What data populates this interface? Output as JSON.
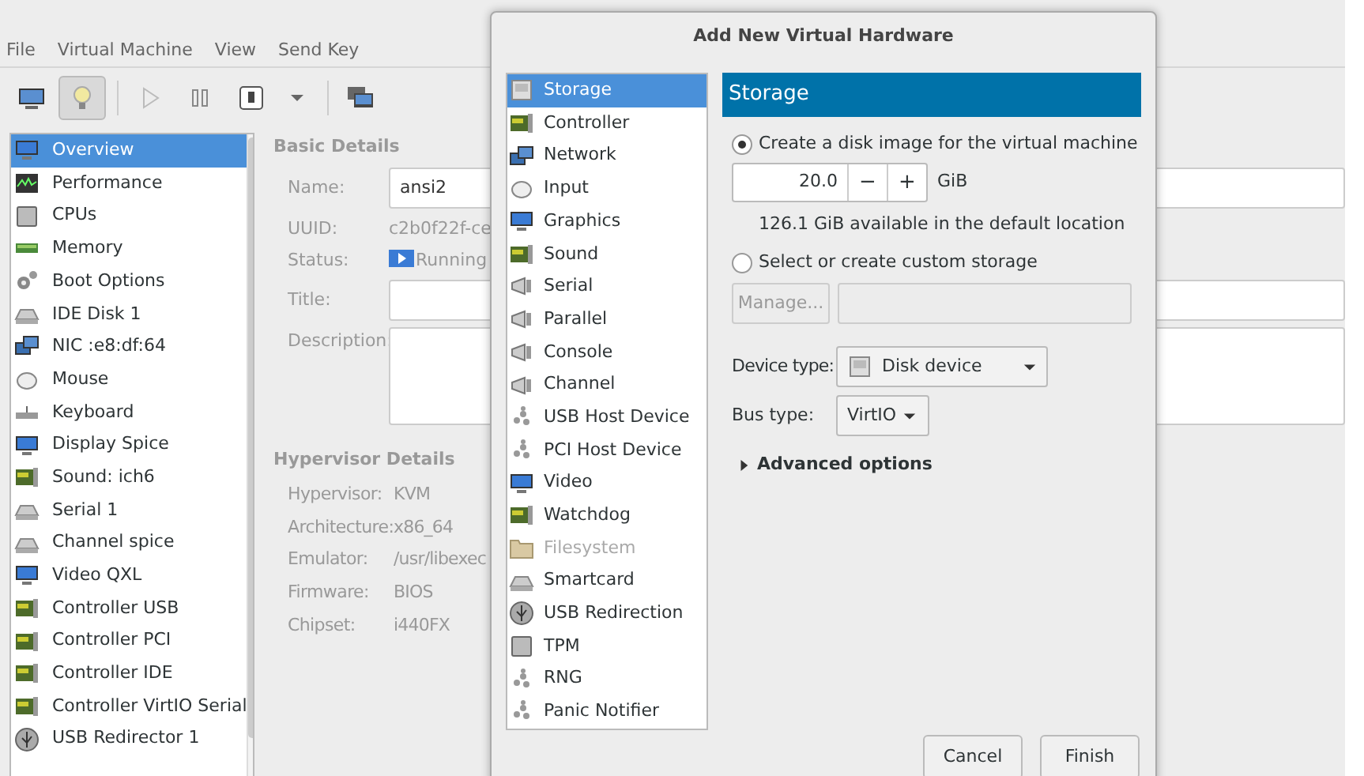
{
  "menu": [
    "File",
    "Virtual Machine",
    "View",
    "Send Key"
  ],
  "toolbar": [
    {
      "selected": false
    },
    {
      "selected": true
    },
    {
      "selected": false
    },
    {
      "selected": false
    },
    {
      "selected": false
    },
    {
      "selected": false
    },
    {
      "selected": false
    }
  ],
  "sidebar": {
    "items": [
      {
        "label": "Overview",
        "selected": true
      },
      {
        "label": "Performance",
        "selected": false
      },
      {
        "label": "CPUs",
        "selected": false
      },
      {
        "label": "Memory",
        "selected": false
      },
      {
        "label": "Boot Options",
        "selected": false
      },
      {
        "label": "IDE Disk 1",
        "selected": false
      },
      {
        "label": "NIC :e8:df:64",
        "selected": false
      },
      {
        "label": "Mouse",
        "selected": false
      },
      {
        "label": "Keyboard",
        "selected": false
      },
      {
        "label": "Display Spice",
        "selected": false
      },
      {
        "label": "Sound: ich6",
        "selected": false
      },
      {
        "label": "Serial 1",
        "selected": false
      },
      {
        "label": "Channel spice",
        "selected": false
      },
      {
        "label": "Video QXL",
        "selected": false
      },
      {
        "label": "Controller USB",
        "selected": false
      },
      {
        "label": "Controller PCI",
        "selected": false
      },
      {
        "label": "Controller IDE",
        "selected": false
      },
      {
        "label": "Controller VirtIO Serial",
        "selected": false
      },
      {
        "label": "USB Redirector 1",
        "selected": false
      }
    ]
  },
  "basic_details": {
    "title": "Basic Details",
    "name_label": "Name:",
    "name_value": "ansi2",
    "uuid_label": "UUID:",
    "uuid_value": "c2b0f22f-ce",
    "status_label": "Status:",
    "status_value": "Running",
    "title_label": "Title:",
    "description_label": "Description:"
  },
  "hypervisor_details": {
    "title": "Hypervisor Details",
    "rows": [
      {
        "label": "Hypervisor:",
        "value": "KVM"
      },
      {
        "label": "Architecture:",
        "value": "x86_64"
      },
      {
        "label": "Emulator:",
        "value": "/usr/libexec"
      },
      {
        "label": "Firmware:",
        "value": "BIOS"
      },
      {
        "label": "Chipset:",
        "value": "i440FX"
      }
    ]
  },
  "dialog": {
    "title": "Add New Virtual Hardware",
    "items": [
      {
        "label": "Storage",
        "selected": true,
        "disabled": false
      },
      {
        "label": "Controller",
        "selected": false,
        "disabled": false
      },
      {
        "label": "Network",
        "selected": false,
        "disabled": false
      },
      {
        "label": "Input",
        "selected": false,
        "disabled": false
      },
      {
        "label": "Graphics",
        "selected": false,
        "disabled": false
      },
      {
        "label": "Sound",
        "selected": false,
        "disabled": false
      },
      {
        "label": "Serial",
        "selected": false,
        "disabled": false
      },
      {
        "label": "Parallel",
        "selected": false,
        "disabled": false
      },
      {
        "label": "Console",
        "selected": false,
        "disabled": false
      },
      {
        "label": "Channel",
        "selected": false,
        "disabled": false
      },
      {
        "label": "USB Host Device",
        "selected": false,
        "disabled": false
      },
      {
        "label": "PCI Host Device",
        "selected": false,
        "disabled": false
      },
      {
        "label": "Video",
        "selected": false,
        "disabled": false
      },
      {
        "label": "Watchdog",
        "selected": false,
        "disabled": false
      },
      {
        "label": "Filesystem",
        "selected": false,
        "disabled": true
      },
      {
        "label": "Smartcard",
        "selected": false,
        "disabled": false
      },
      {
        "label": "USB Redirection",
        "selected": false,
        "disabled": false
      },
      {
        "label": "TPM",
        "selected": false,
        "disabled": false
      },
      {
        "label": "RNG",
        "selected": false,
        "disabled": false
      },
      {
        "label": "Panic Notifier",
        "selected": false,
        "disabled": false
      }
    ],
    "header": "Storage",
    "options": [
      {
        "label": "Create a disk image for the virtual machine",
        "selected": true
      },
      {
        "label": "Select or create custom storage",
        "selected": false
      }
    ],
    "size_value": "20.0",
    "minus": "−",
    "plus": "+",
    "unit": "GiB",
    "available": "126.1 GiB available in the default location",
    "manage_button": "Manage...",
    "device_type_label": "Device type:",
    "device_type_value": "Disk device",
    "bus_type_label": "Bus type:",
    "bus_type_value": "VirtIO",
    "advanced": {
      "label": "Advanced options",
      "expanded": false
    },
    "buttons": [
      "Cancel",
      "Finish"
    ]
  }
}
